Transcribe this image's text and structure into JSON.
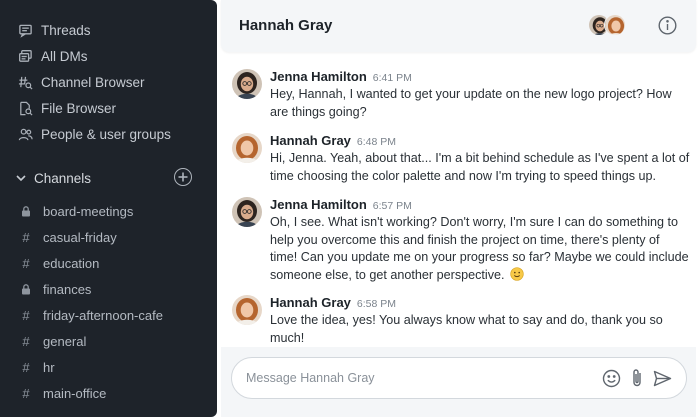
{
  "sidebar": {
    "nav": [
      {
        "label": "Threads",
        "icon": "threads-icon"
      },
      {
        "label": "All DMs",
        "icon": "dms-icon"
      },
      {
        "label": "Channel Browser",
        "icon": "channel-browser-icon"
      },
      {
        "label": "File Browser",
        "icon": "file-browser-icon"
      },
      {
        "label": "People & user groups",
        "icon": "people-icon"
      }
    ],
    "channels_header": "Channels",
    "channels": [
      {
        "name": "board-meetings",
        "private": true
      },
      {
        "name": "casual-friday",
        "private": false
      },
      {
        "name": "education",
        "private": false
      },
      {
        "name": "finances",
        "private": true
      },
      {
        "name": "friday-afternoon-cafe",
        "private": false
      },
      {
        "name": "general",
        "private": false
      },
      {
        "name": "hr",
        "private": false
      },
      {
        "name": "main-office",
        "private": false
      }
    ]
  },
  "header": {
    "title": "Hannah Gray"
  },
  "messages": [
    {
      "author": "Jenna Hamilton",
      "time": "6:41 PM",
      "text": "Hey, Hannah, I wanted to get your update on the new logo project? How are things going?"
    },
    {
      "author": "Hannah Gray",
      "time": "6:48 PM",
      "text": "Hi, Jenna. Yeah, about that... I'm a bit behind schedule as I've spent a lot of time choosing the color palette and now I'm trying to speed things up."
    },
    {
      "author": "Jenna Hamilton",
      "time": "6:57 PM",
      "text": "Oh, I see. What isn't working? Don't worry, I'm sure I can do something to help you overcome this and finish the project on time, there's plenty of time! Can you update me on your progress so far? Maybe we could include someone else, to get another perspective."
    },
    {
      "author": "Hannah Gray",
      "time": "6:58 PM",
      "text": "Love the idea, yes! You always know what to say and do, thank you so much!"
    }
  ],
  "composer": {
    "placeholder": "Message Hannah Gray"
  },
  "colors": {
    "sidebar_bg": "#1e232a",
    "topbar_bg": "#f4f6f8",
    "text_dark": "#1d2329"
  }
}
